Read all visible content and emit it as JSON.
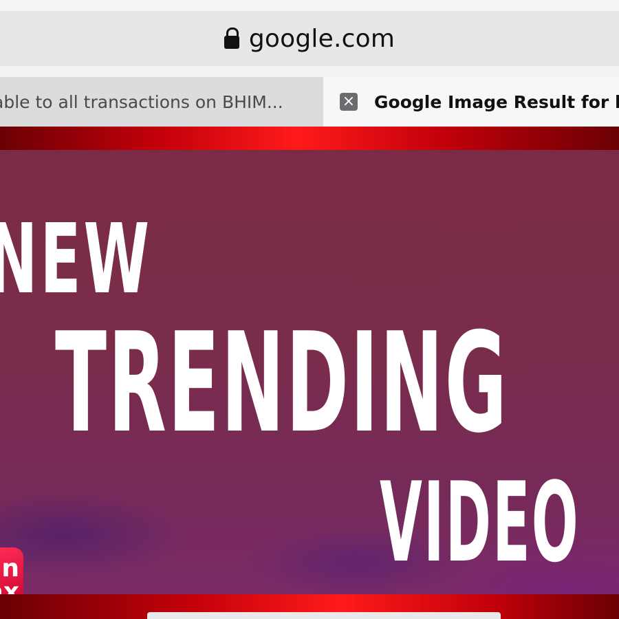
{
  "browser": {
    "address_bar": {
      "url": "google.com",
      "lock_icon": "lock-icon"
    },
    "tabs": [
      {
        "title": "able to all transactions on BHIM...",
        "active": false
      },
      {
        "title": "Google Image Result for htt",
        "active": true,
        "close_icon": "close-icon",
        "close_glyph": "×"
      }
    ]
  },
  "thumbnail": {
    "lines": [
      "NEW",
      "TRENDING",
      "VIDEO"
    ],
    "app_logo": {
      "glyph_top": "n",
      "glyph_bottom": "ax"
    },
    "colors": {
      "band_red": "#ff1a1a",
      "panel": "#7a2c4b",
      "text": "#ffffff"
    }
  }
}
